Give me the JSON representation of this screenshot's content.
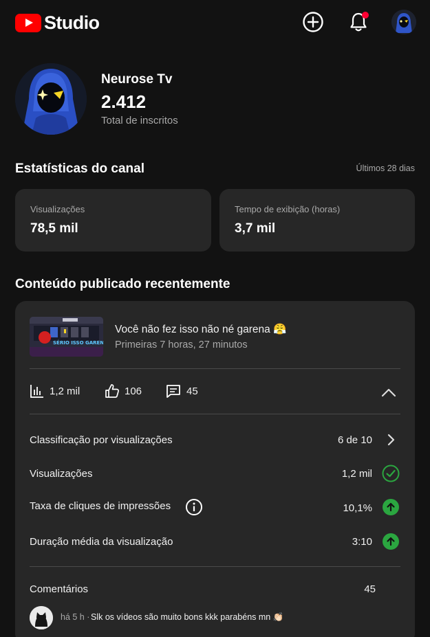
{
  "app": {
    "logo_text": "Studio",
    "brand_color": "#ff0000",
    "icons": {
      "create": "add-circle-icon",
      "notifications": "bell-icon",
      "account": "hooded-figure-avatar"
    }
  },
  "channel": {
    "name": "Neurose Tv",
    "subscriber_count": "2.412",
    "subscriber_label": "Total de inscritos"
  },
  "stats": {
    "title": "Estatísticas do canal",
    "period": "Últimos 28 dias",
    "cards": [
      {
        "label": "Visualizações",
        "value": "78,5 mil"
      },
      {
        "label": "Tempo de exibição (horas)",
        "value": "3,7 mil"
      }
    ]
  },
  "recent": {
    "title": "Conteúdo publicado recentemente",
    "video": {
      "title": "Você não fez isso não né garena 😤",
      "subtitle": "Primeiras 7 horas, 27 minutos",
      "thumbnail_text": "SÉRIO ISSO GARENA"
    },
    "metrics": {
      "views": "1,2 mil",
      "likes": "106",
      "comments": "45"
    },
    "rows": [
      {
        "label": "Classificação por visualizações",
        "value": "6 de 10",
        "icon": "chevron-right-icon"
      },
      {
        "label": "Visualizações",
        "value": "1,2 mil",
        "icon": "check-circle-icon"
      },
      {
        "label": "Taxa de cliques de impressões",
        "value": "10,1%",
        "icon": "arrow-up-circle-icon",
        "info_icon": "info-icon"
      },
      {
        "label": "Duração média da visualização",
        "value": "3:10",
        "icon": "arrow-up-circle-icon"
      }
    ],
    "comments_section": {
      "label": "Comentários",
      "count": "45",
      "latest": {
        "time": "há 5 h ·",
        "text": "Slk os vídeos são muito bons kkk parabéns mn 👏🏻"
      }
    }
  },
  "colors": {
    "background": "#121212",
    "card": "#272727",
    "positive": "#2ba640",
    "notification_dot": "#ff0033"
  }
}
